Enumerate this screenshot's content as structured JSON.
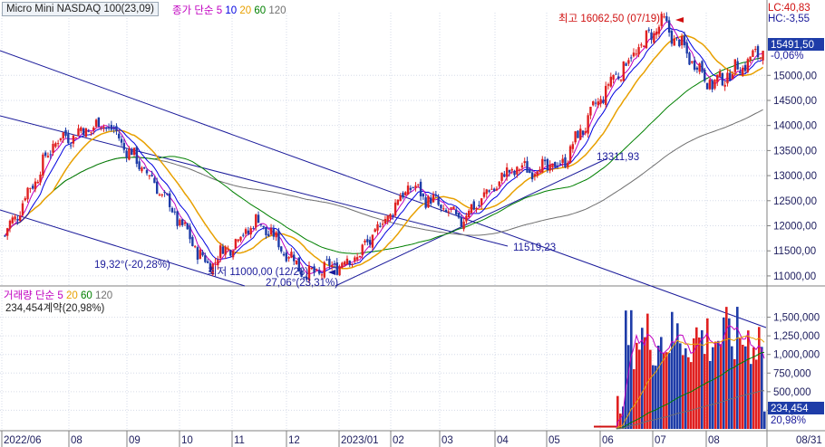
{
  "chart_data": [
    {
      "type": "candlestick",
      "title": "Micro Mini NASDAQ 100(23,09)",
      "subtitle": "종가 단순",
      "ma_periods": [
        "5",
        "10",
        "20",
        "60",
        "120"
      ],
      "ma_colors": [
        "#c000c0",
        "#0000e0",
        "#e8a000",
        "#008000",
        "#707070"
      ],
      "ylim": [
        10800,
        16250
      ],
      "y_ticks": [
        11000,
        11500,
        12000,
        12500,
        13000,
        13500,
        14000,
        14500,
        15000
      ],
      "y_tick_labels": [
        "11000,00",
        "11500,00",
        "12000,00",
        "12500,00",
        "13000,00",
        "13500,00",
        "14000,00",
        "14500,00",
        "15000,00"
      ],
      "last_price": "15491,50",
      "last_change": "-0,06%",
      "lc_label": "LC:40,83",
      "hc_label": "HC:-3,55",
      "annotations": {
        "high": "최고 16062,50 (07/19)",
        "low": "최저 11000,00 (12/28)",
        "angle1": "19,32°(-20,28%)",
        "angle2": "27,06°(23,31%)",
        "trend_value_1": "13311,93",
        "trend_value_2": "11519,23"
      },
      "x_labels": [
        "2022/06",
        "08",
        "09",
        "10",
        "11",
        "12",
        "2023/01",
        "02",
        "03",
        "04",
        "05",
        "06",
        "07",
        "08",
        "08/31"
      ],
      "key_points": [
        {
          "date": "2022/06",
          "close": 11800
        },
        {
          "date": "2022/08",
          "close": 13700
        },
        {
          "date": "2022/08",
          "close": 14050
        },
        {
          "date": "2022/09",
          "close": 12800
        },
        {
          "date": "2022/10",
          "close": 11200
        },
        {
          "date": "2022/11",
          "close": 12100
        },
        {
          "date": "2022/12",
          "close": 11000
        },
        {
          "date": "2023/01",
          "close": 11400
        },
        {
          "date": "2023/02",
          "close": 12800
        },
        {
          "date": "2023/03",
          "close": 12100
        },
        {
          "date": "2023/04",
          "close": 13100
        },
        {
          "date": "2023/05",
          "close": 13200
        },
        {
          "date": "2023/06",
          "close": 14900
        },
        {
          "date": "2023/07",
          "close": 16062.5
        },
        {
          "date": "2023/08",
          "close": 14800
        },
        {
          "date": "2023/08/31",
          "close": 15491.5
        }
      ]
    },
    {
      "type": "bar",
      "title": "거래량",
      "subtitle": "단순",
      "ma_periods": [
        "5",
        "20",
        "60",
        "120"
      ],
      "ma_colors": [
        "#c000c0",
        "#e8a000",
        "#008000",
        "#707070"
      ],
      "ylim": [
        0,
        1750000
      ],
      "y_ticks": [
        250000,
        500000,
        750000,
        1000000,
        1250000,
        1500000
      ],
      "y_tick_labels": [
        "250,000",
        "500,000",
        "750,000",
        "1,000,000",
        "1,250,000",
        "1,500,000"
      ],
      "last_volume": "234,454",
      "volume_info": "234,454계약(20,98%)",
      "volume_pct": "20,98%",
      "volume_start": "2023/06",
      "volume_range": [
        800000,
        1650000
      ]
    }
  ],
  "colors": {
    "up": "#e02020",
    "down": "#1e3ca8",
    "axis_text": "#202060",
    "accent_label": "#1e3ca8"
  }
}
